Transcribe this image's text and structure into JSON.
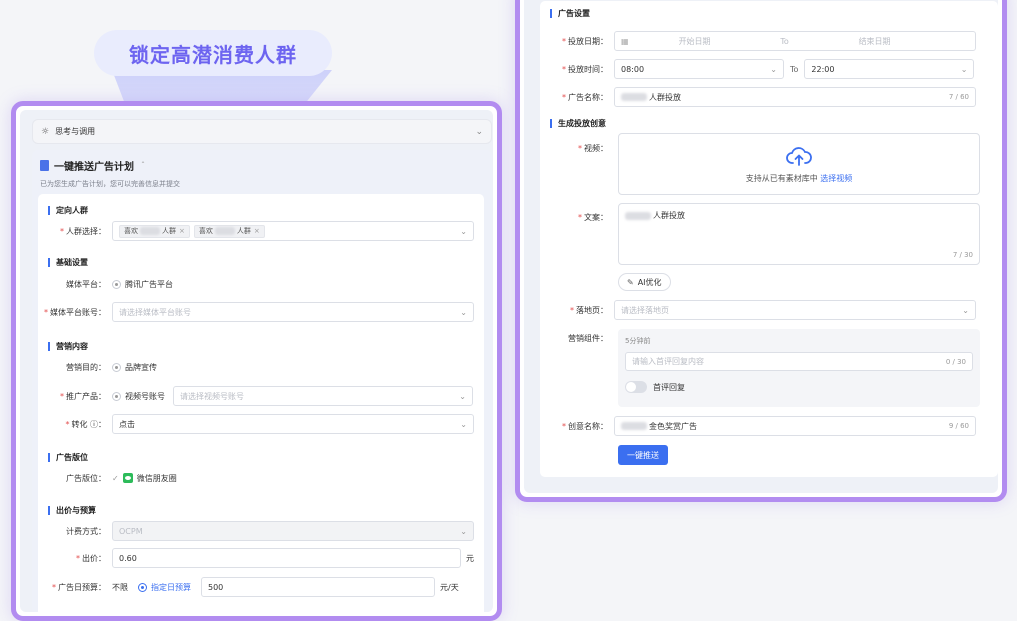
{
  "headline": "锁定高潜消费人群",
  "left": {
    "collapse_label": "思考与调用",
    "plan_title": "一键推送广告计划",
    "plan_subtitle": "已为您生成广告计划，您可以完善信息并提交",
    "sections": {
      "audience": "定向人群",
      "basic": "基础设置",
      "marketing": "营销内容",
      "placement": "广告版位",
      "bid": "出价与预算"
    },
    "audience_label": "人群选择：",
    "audience_tags": [
      {
        "prefix": "喜欢",
        "suffix": "人群"
      },
      {
        "prefix": "喜欢",
        "suffix": "人群"
      }
    ],
    "media_platform_label": "媒体平台：",
    "media_platform_value": "腾讯广告平台",
    "media_account_label": "媒体平台账号：",
    "media_account_placeholder": "请选择媒体平台账号",
    "marketing_goal_label": "营销目的：",
    "marketing_goal_value": "品牌宣传",
    "product_label": "推广产品：",
    "product_value": "视频号账号",
    "product_placeholder": "请选择视频号账号",
    "conversion_label": "转化 ⓘ：",
    "conversion_value": "点击",
    "placement_label": "广告版位：",
    "placement_value": "微信朋友圈",
    "billing_label": "计费方式：",
    "billing_value": "OCPM",
    "bid_label": "出价：",
    "bid_value": "0.60",
    "bid_unit": "元",
    "budget_label": "广告日预算：",
    "budget_unlimited": "不限",
    "budget_specified": "指定日预算",
    "budget_value": "500",
    "budget_unit": "元/天"
  },
  "right": {
    "sections": {
      "ad_settings": "广告设置",
      "creative": "生成投放创意"
    },
    "date_label": "投放日期：",
    "date_start_placeholder": "开始日期",
    "date_to": "To",
    "date_end_placeholder": "结束日期",
    "time_label": "投放时间：",
    "time_start": "08:00",
    "time_to": "To",
    "time_end": "22:00",
    "ad_name_label": "广告名称：",
    "ad_name_value": "人群投放",
    "ad_name_count": "7 / 60",
    "video_label": "视频：",
    "upload_hint": "支持从已有素材库中",
    "upload_link": "选择视频",
    "copy_label": "文案：",
    "copy_value": "人群投放",
    "copy_count": "7 / 30",
    "ai_button": "AI优化",
    "landing_label": "落地页：",
    "landing_placeholder": "请选择落地页",
    "component_label": "营销组件：",
    "component_sub": "5分钟前",
    "component_placeholder": "请输入首评回复内容",
    "component_count": "0 / 30",
    "first_reply_label": "首评回复",
    "creative_name_label": "创意名称：",
    "creative_name_value": "金色奖赏广告",
    "creative_name_count": "9 / 60",
    "submit_button": "一键推送"
  },
  "colors": {
    "accent": "#3b6ff0",
    "frame": "#b28cf0",
    "headline": "#6d64f0"
  }
}
